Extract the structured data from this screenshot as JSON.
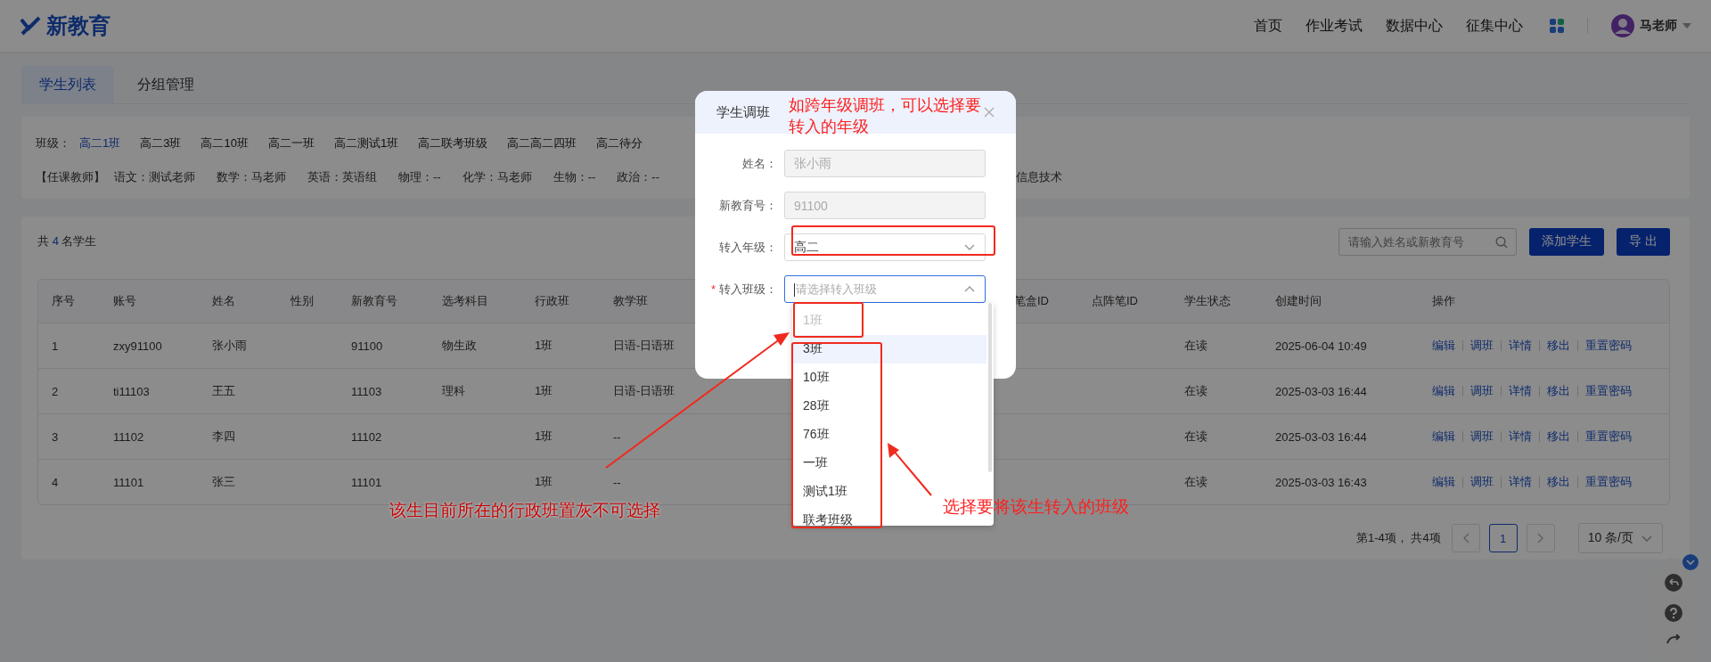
{
  "header": {
    "logo": "新教育",
    "nav": [
      "首页",
      "作业考试",
      "数据中心",
      "征集中心"
    ],
    "user": "马老师"
  },
  "tabs": [
    {
      "label": "学生列表",
      "selected": true
    },
    {
      "label": "分组管理",
      "selected": false
    }
  ],
  "filters": {
    "class_label": "班级：",
    "classes": [
      {
        "label": "高二1班",
        "selected": true
      },
      {
        "label": "高二3班",
        "selected": false
      },
      {
        "label": "高二10班",
        "selected": false
      },
      {
        "label": "高二一班",
        "selected": false
      },
      {
        "label": "高二测试1班",
        "selected": false
      },
      {
        "label": "高二联考班级",
        "selected": false
      },
      {
        "label": "高二高二四班",
        "selected": false
      },
      {
        "label": "高二待分",
        "selected": false
      }
    ],
    "teachers_label": "【任课教师】",
    "teachers": [
      "语文：测试老师",
      "数学：马老师",
      "英语：英语组",
      "物理：--",
      "化学：马老师",
      "生物：--",
      "政治：--"
    ],
    "teachers_tail": "信息技术"
  },
  "toolbar": {
    "count_prefix": "共",
    "count": "4",
    "count_suffix": "名学生",
    "search_placeholder": "请输入姓名或新教育号",
    "buttons": [
      "添加学生",
      "导 出"
    ]
  },
  "table": {
    "columns": [
      "序号",
      "账号",
      "姓名",
      "性别",
      "新教育号",
      "选考科目",
      "行政班",
      "教学班",
      "",
      "笔盒ID",
      "点阵笔ID",
      "学生状态",
      "创建时间",
      "操作"
    ],
    "rows": [
      {
        "cells": [
          "1",
          "zxy91100",
          "张小雨",
          "",
          "91100",
          "物生政",
          "1班",
          "日语-日语班",
          "",
          "",
          "",
          "在读",
          "2025-06-04 10:49"
        ],
        "actions": [
          "编辑",
          "调班",
          "详情",
          "移出",
          "重置密码"
        ]
      },
      {
        "cells": [
          "2",
          "ti11103",
          "王五",
          "",
          "11103",
          "理科",
          "1班",
          "日语-日语班",
          "",
          "",
          "",
          "在读",
          "2025-03-03 16:44"
        ],
        "actions": [
          "编辑",
          "调班",
          "详情",
          "移出",
          "重置密码"
        ]
      },
      {
        "cells": [
          "3",
          "11102",
          "李四",
          "",
          "11102",
          "",
          "1班",
          "--",
          "",
          "",
          "",
          "在读",
          "2025-03-03 16:44"
        ],
        "actions": [
          "编辑",
          "调班",
          "详情",
          "移出",
          "重置密码"
        ]
      },
      {
        "cells": [
          "4",
          "11101",
          "张三",
          "",
          "11101",
          "",
          "1班",
          "--",
          "",
          "",
          "",
          "在读",
          "2025-03-03 16:43"
        ],
        "actions": [
          "编辑",
          "调班",
          "详情",
          "移出",
          "重置密码"
        ]
      }
    ]
  },
  "pagination": {
    "summary": "第1-4项， 共4项",
    "pages": [
      {
        "label": "1",
        "selected": true
      }
    ],
    "page_size": "10 条/页"
  },
  "modal": {
    "title": "学生调班",
    "fields": [
      {
        "kind": "input",
        "label": "姓名：",
        "value": "张小雨",
        "disabled": true
      },
      {
        "kind": "input",
        "label": "新教育号：",
        "value": "91100",
        "disabled": true
      },
      {
        "kind": "select",
        "label": "转入年级：",
        "value": "高二",
        "expanded": false
      },
      {
        "kind": "select",
        "label": "转入班级：",
        "mark": "*",
        "placeholder": "请选择转入班级",
        "expanded": true
      }
    ]
  },
  "dropdown": {
    "options": [
      {
        "label": "1班",
        "disabled": true,
        "highlighted": false
      },
      {
        "label": "3班",
        "disabled": false,
        "highlighted": true
      },
      {
        "label": "10班",
        "disabled": false,
        "highlighted": false
      },
      {
        "label": "28班",
        "disabled": false,
        "highlighted": false
      },
      {
        "label": "76班",
        "disabled": false,
        "highlighted": false
      },
      {
        "label": "一班",
        "disabled": false,
        "highlighted": false
      },
      {
        "label": "测试1班",
        "disabled": false,
        "highlighted": false
      },
      {
        "label": "联考班级",
        "disabled": false,
        "highlighted": false
      }
    ]
  },
  "annotations": [
    {
      "kind": "grade",
      "text": "如跨年级调班，可以选择要转入的年级"
    },
    {
      "kind": "current",
      "text": "该生目前所在的行政班置灰不可选择"
    },
    {
      "kind": "target",
      "text": "选择要将该生转入的班级"
    }
  ]
}
